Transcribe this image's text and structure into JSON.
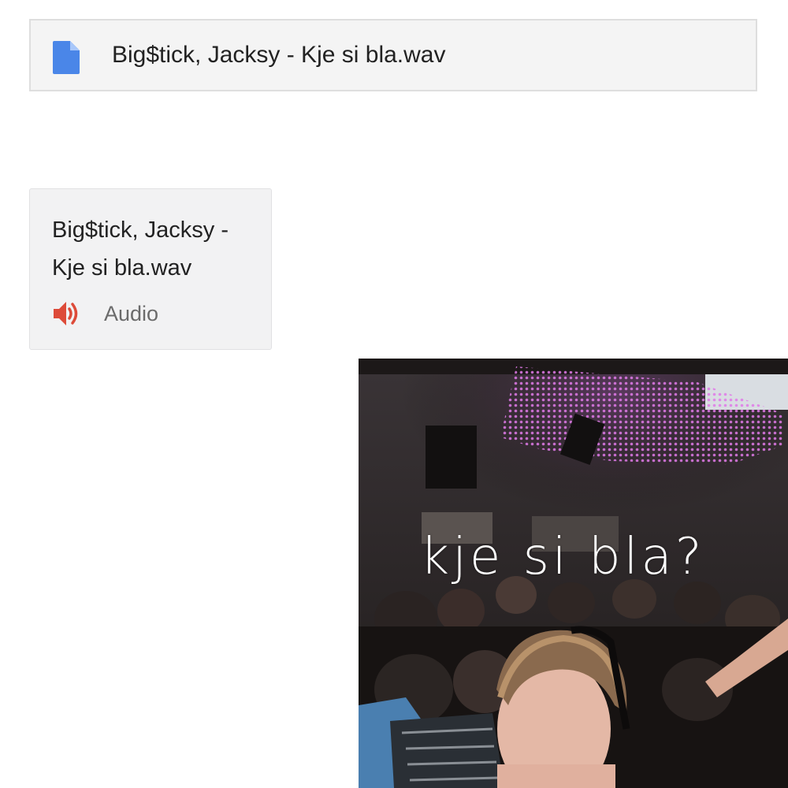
{
  "file_bar": {
    "icon": "document-icon",
    "file_name": "Big$tick, Jacksy - Kje si bla.wav",
    "icon_color": "#4a86e8"
  },
  "attachment": {
    "title": "Big$tick, Jacksy - Kje si bla.wav",
    "type_icon": "speaker-icon",
    "type_label": "Audio",
    "icon_color": "#dd4b39"
  },
  "cover_art": {
    "title_text": "kje si bla?"
  }
}
